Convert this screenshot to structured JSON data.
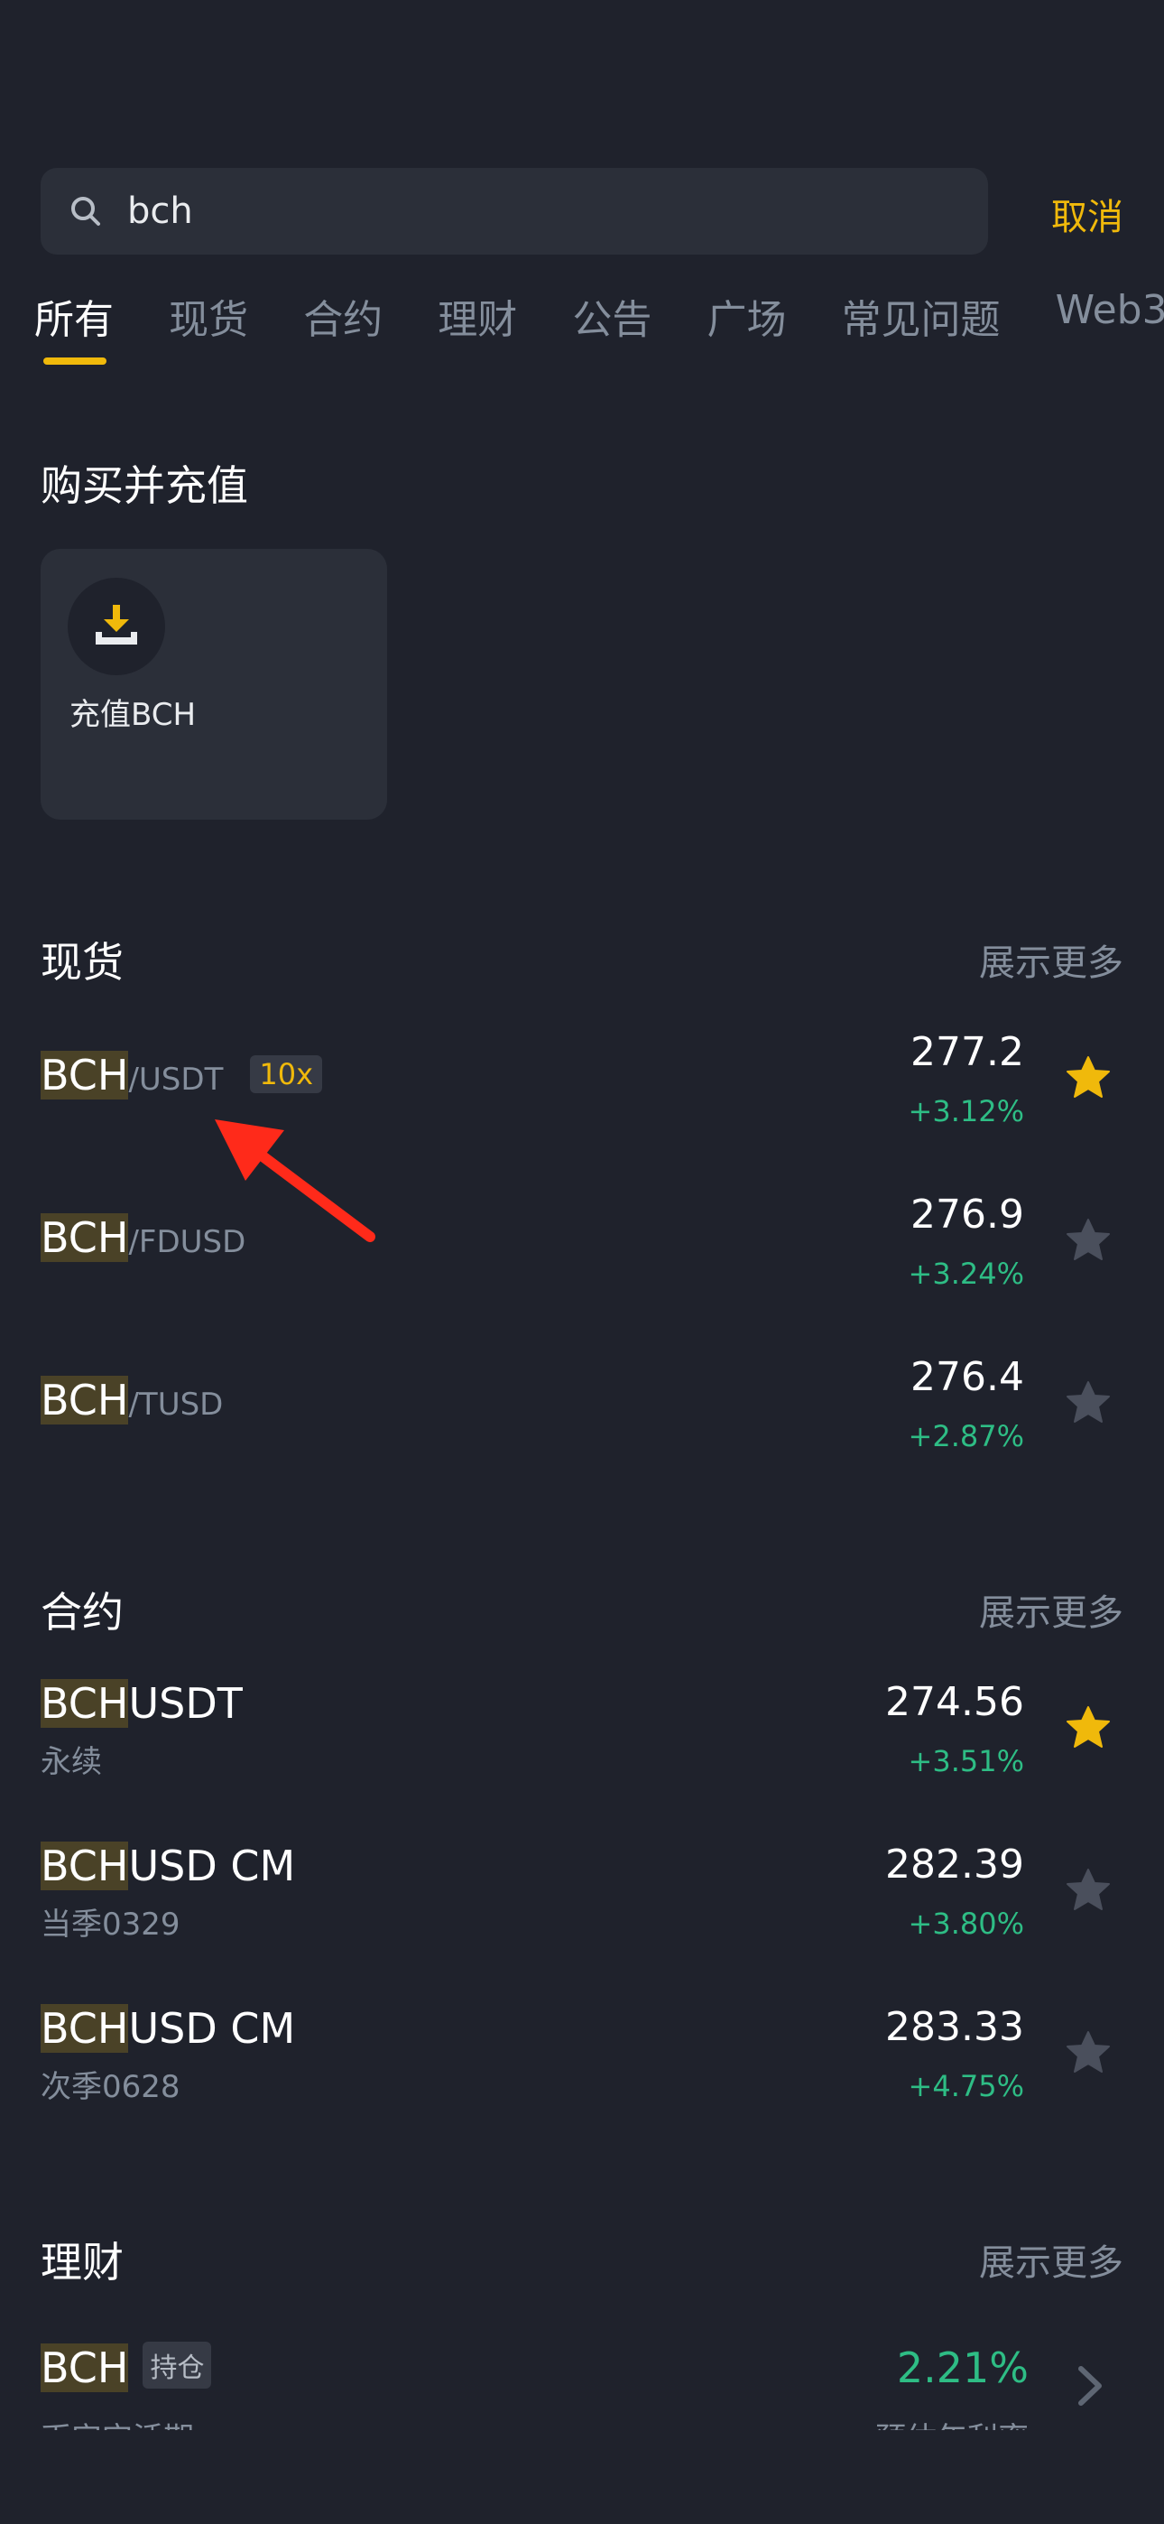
{
  "search": {
    "value": "bch",
    "cancel_label": "取消"
  },
  "tabs": [
    {
      "label": "所有"
    },
    {
      "label": "现货"
    },
    {
      "label": "合约"
    },
    {
      "label": "理财"
    },
    {
      "label": "公告"
    },
    {
      "label": "广场"
    },
    {
      "label": "常见问题"
    },
    {
      "label": "Web3"
    }
  ],
  "buy": {
    "title": "购买并充值",
    "card_label": "充值BCH",
    "icon": "download-icon"
  },
  "spot": {
    "title": "现货",
    "show_more": "展示更多",
    "items": [
      {
        "base": "BCH",
        "quote": "/USDT",
        "leverage": "10x",
        "price": "277.2",
        "change": "+3.12%",
        "favorite": true
      },
      {
        "base": "BCH",
        "quote": "/FDUSD",
        "price": "276.9",
        "change": "+3.24%",
        "favorite": false
      },
      {
        "base": "BCH",
        "quote": "/TUSD",
        "price": "276.4",
        "change": "+2.87%",
        "favorite": false
      }
    ]
  },
  "futures": {
    "title": "合约",
    "show_more": "展示更多",
    "items": [
      {
        "base": "BCH",
        "rest": "USDT",
        "sub": "永续",
        "price": "274.56",
        "change": "+3.51%",
        "favorite": true
      },
      {
        "base": "BCH",
        "rest": "USD CM",
        "sub": "当季0329",
        "price": "282.39",
        "change": "+3.80%",
        "favorite": false
      },
      {
        "base": "BCH",
        "rest": "USD CM",
        "sub": "次季0628",
        "price": "283.33",
        "change": "+4.75%",
        "favorite": false
      }
    ]
  },
  "earn": {
    "title": "理财",
    "show_more": "展示更多",
    "items": [
      {
        "base": "BCH",
        "badge": "持仓",
        "sub": "币安宝活期",
        "rate": "2.21%",
        "rate_label": "预估年利率"
      }
    ]
  },
  "colors": {
    "background": "#1f222c",
    "accent": "#f0b90b",
    "positive": "#2ebd85",
    "muted": "#848e9c",
    "highlight": "#4a4227",
    "annotation": "#ff2a1a"
  }
}
